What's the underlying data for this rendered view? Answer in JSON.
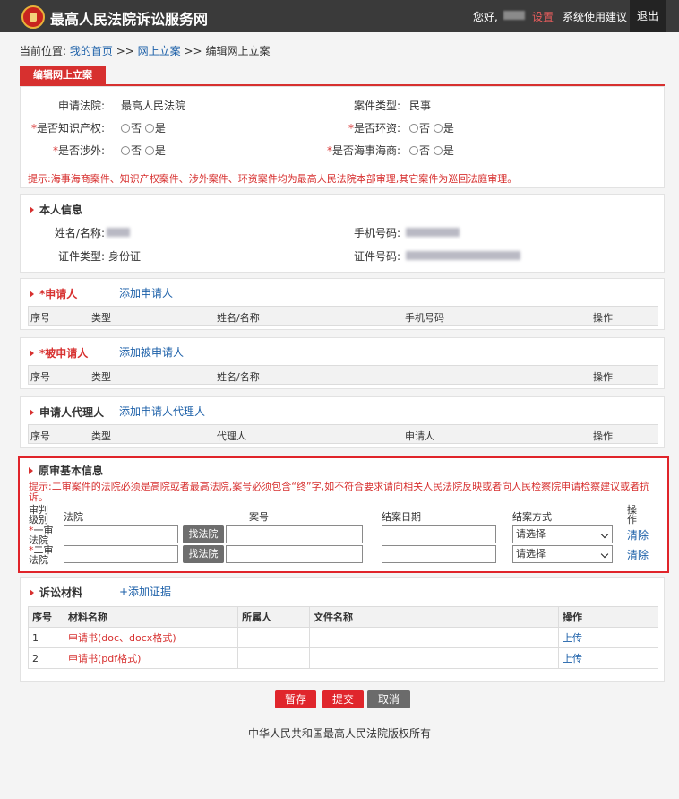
{
  "header": {
    "site_title": "最高人民法院诉讼服务网",
    "greeting": "您好,",
    "settings": "设置",
    "suggest": "系统使用建议",
    "logout": "退出"
  },
  "breadcrumb": {
    "prefix": "当前位置:",
    "home": "我的首页",
    "sep1": ">>",
    "online": "网上立案",
    "sep2": ">>",
    "current": "编辑网上立案"
  },
  "tab": {
    "label": "编辑网上立案"
  },
  "case_form": {
    "court_label": "申请法院:",
    "court_value": "最高人民法院",
    "type_label": "案件类型:",
    "type_value": "民事",
    "ip_label": "是否知识产权:",
    "env_label": "是否环资:",
    "foreign_label": "是否涉外:",
    "maritime_label": "是否海事海商:",
    "req_mark": "*",
    "opt_no": "否",
    "opt_yes": "是",
    "hint": "提示:海事海商案件、知识产权案件、涉外案件、环资案件均为最高人民法院本部审理,其它案件为巡回法庭审理。"
  },
  "personal": {
    "title": "本人信息",
    "name_label": "姓名/名称:",
    "phone_label": "手机号码:",
    "idtype_label": "证件类型:",
    "idtype_value": "身份证",
    "idno_label": "证件号码:"
  },
  "applicant": {
    "title": "*申请人",
    "add": "添加申请人",
    "cols": [
      "序号",
      "类型",
      "姓名/名称",
      "手机号码",
      "操作"
    ]
  },
  "respondent": {
    "title": "*被申请人",
    "add": "添加被申请人",
    "cols": [
      "序号",
      "类型",
      "姓名/名称",
      "操作"
    ]
  },
  "agent": {
    "title": "申请人代理人",
    "add": "添加申请人代理人",
    "cols": [
      "序号",
      "类型",
      "代理人",
      "申请人",
      "操作"
    ]
  },
  "original": {
    "title": "原审基本信息",
    "hint": "提示:二审案件的法院必须是高院或者最高法院,案号必须包含“终”字,如不符合要求请向相关人民法院反映或者向人民检察院申请检察建议或者抗诉。",
    "cols": {
      "level": "审判级别",
      "court": "法院",
      "caseno": "案号",
      "date": "结案日期",
      "method": "结案方式",
      "op": "操作"
    },
    "rows": [
      {
        "mark": "*",
        "level": "一审法院",
        "find": "找法院",
        "select": "请选择",
        "clear": "清除"
      },
      {
        "mark": "*",
        "level": "二审法院",
        "find": "找法院",
        "select": "请选择",
        "clear": "清除"
      }
    ]
  },
  "materials": {
    "title": "诉讼材料",
    "add": "+添加证据",
    "cols": [
      "序号",
      "材料名称",
      "所属人",
      "文件名称",
      "操作"
    ],
    "rows": [
      {
        "no": "1",
        "name": "申请书(doc、docx格式)",
        "op": "上传"
      },
      {
        "no": "2",
        "name": "申请书(pdf格式)",
        "op": "上传"
      }
    ]
  },
  "actions": {
    "save": "暂存",
    "submit": "提交",
    "cancel": "取消"
  },
  "footer": {
    "copyright": "中华人民共和国最高人民法院版权所有"
  },
  "colors": {
    "accent": "#d7302f",
    "link": "#1b5fa8",
    "topbar": "#3a3a3a"
  }
}
